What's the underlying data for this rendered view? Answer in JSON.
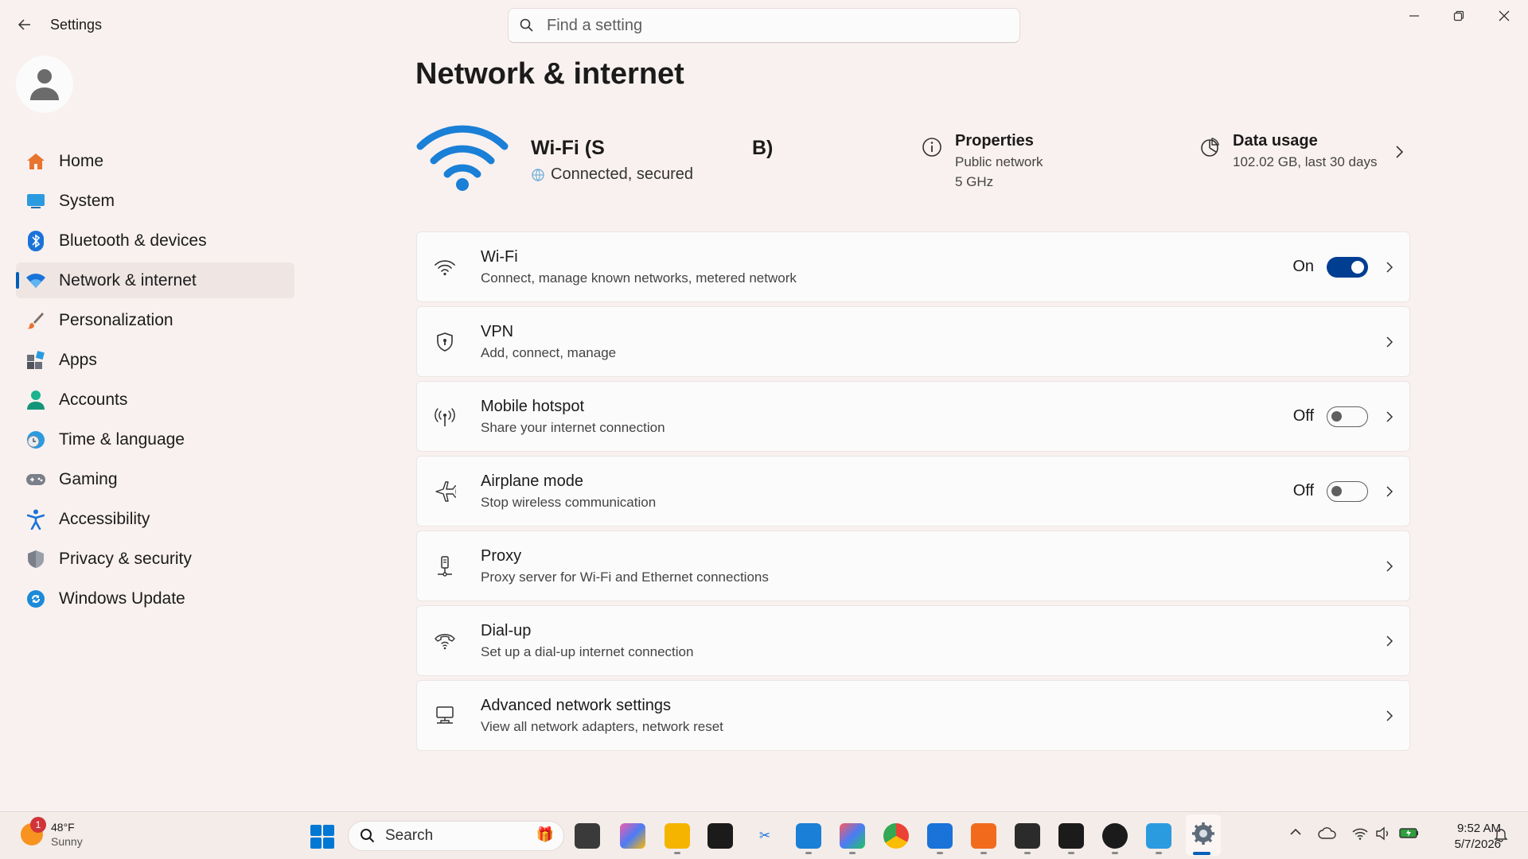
{
  "window": {
    "title": "Settings",
    "search_placeholder": "Find a setting"
  },
  "sidebar": {
    "items": [
      {
        "label": "Home",
        "icon": "home-icon"
      },
      {
        "label": "System",
        "icon": "system-icon"
      },
      {
        "label": "Bluetooth & devices",
        "icon": "bluetooth-icon"
      },
      {
        "label": "Network & internet",
        "icon": "network-icon",
        "active": true
      },
      {
        "label": "Personalization",
        "icon": "brush-icon"
      },
      {
        "label": "Apps",
        "icon": "apps-icon"
      },
      {
        "label": "Accounts",
        "icon": "accounts-icon"
      },
      {
        "label": "Time & language",
        "icon": "globe-clock-icon"
      },
      {
        "label": "Gaming",
        "icon": "gamepad-icon"
      },
      {
        "label": "Accessibility",
        "icon": "accessibility-icon"
      },
      {
        "label": "Privacy & security",
        "icon": "shield-icon"
      },
      {
        "label": "Windows Update",
        "icon": "update-icon"
      }
    ]
  },
  "main": {
    "title": "Network & internet",
    "hero": {
      "network_name": "Wi-Fi (S",
      "network_name_suffix": "B)",
      "status": "Connected, secured",
      "properties_title": "Properties",
      "properties_line1": "Public network",
      "properties_line2": "5 GHz",
      "usage_title": "Data usage",
      "usage_detail": "102.02 GB, last 30 days"
    },
    "cards": [
      {
        "title": "Wi-Fi",
        "subtitle": "Connect, manage known networks, metered network",
        "toggle": "On"
      },
      {
        "title": "VPN",
        "subtitle": "Add, connect, manage"
      },
      {
        "title": "Mobile hotspot",
        "subtitle": "Share your internet connection",
        "toggle": "Off"
      },
      {
        "title": "Airplane mode",
        "subtitle": "Stop wireless communication",
        "toggle": "Off"
      },
      {
        "title": "Proxy",
        "subtitle": "Proxy server for Wi-Fi and Ethernet connections"
      },
      {
        "title": "Dial-up",
        "subtitle": "Set up a dial-up internet connection"
      },
      {
        "title": "Advanced network settings",
        "subtitle": "View all network adapters, network reset"
      }
    ]
  },
  "taskbar": {
    "weather_temp": "48°F",
    "weather_condition": "Sunny",
    "weather_badge": "1",
    "search_label": "Search",
    "time": "9:52 AM",
    "date": "5/7/2026"
  },
  "colors": {
    "accent": "#005fb8",
    "toggle_on": "#003e92",
    "background": "#f9f1ef",
    "card": "#fbfbfb"
  }
}
